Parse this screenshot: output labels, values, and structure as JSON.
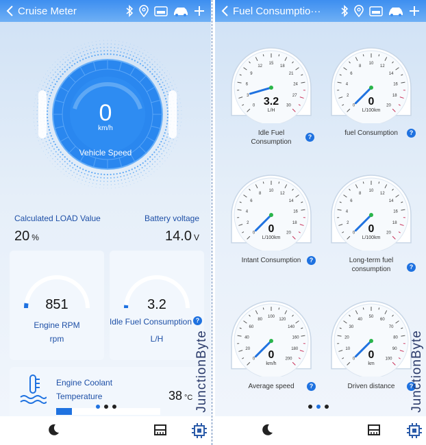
{
  "left": {
    "title": "Cruise Meter",
    "speed": {
      "value": "0",
      "unit": "km/h",
      "label": "Vehicle Speed"
    },
    "load": {
      "label": "Calculated LOAD Value",
      "value": "20",
      "unit": "%"
    },
    "battery": {
      "label": "Battery voltage",
      "value": "14.0",
      "unit": "V"
    },
    "rpm": {
      "value": "851",
      "label": "Engine RPM",
      "unit": "rpm",
      "fraction": 0.05
    },
    "idle": {
      "value": "3.2",
      "label": "Idle Fuel Consumption",
      "unit": "L/H",
      "fraction": 0.03
    },
    "coolant": {
      "label_line1": "Engine Coolant",
      "label_line2": "Temperature",
      "value": "38",
      "unit": "°C",
      "fraction": 0.15
    },
    "watermark": "JunctionByte"
  },
  "right": {
    "title": "Fuel Consumptio···",
    "watermark": "JunctionByte",
    "gauges": [
      {
        "value": "3.2",
        "unit": "L/H",
        "label_line1": "Idle Fuel",
        "label_line2": "Consumption",
        "ticks": [
          "0",
          "3",
          "6",
          "9",
          "12",
          "15",
          "18",
          "21",
          "24",
          "27",
          "30"
        ],
        "fraction": 0.107
      },
      {
        "value": "0",
        "unit": "L/100km",
        "label_line1": "fuel Consumption",
        "label_line2": "",
        "ticks": [
          "0",
          "2",
          "4",
          "6",
          "8",
          "10",
          "12",
          "14",
          "16",
          "18",
          "20"
        ],
        "fraction": 0
      },
      {
        "value": "0",
        "unit": "L/100km",
        "label_line1": "Intant Consumption",
        "label_line2": "",
        "ticks": [
          "0",
          "2",
          "4",
          "6",
          "8",
          "10",
          "12",
          "14",
          "16",
          "18",
          "20"
        ],
        "fraction": 0
      },
      {
        "value": "0",
        "unit": "L/100km",
        "label_line1": "Long-term fuel",
        "label_line2": "consumption",
        "ticks": [
          "0",
          "2",
          "4",
          "6",
          "8",
          "10",
          "12",
          "14",
          "16",
          "18",
          "20"
        ],
        "fraction": 0
      },
      {
        "value": "0",
        "unit": "km/h",
        "label_line1": "Average speed",
        "label_line2": "",
        "ticks": [
          "0",
          "20",
          "40",
          "60",
          "80",
          "100",
          "120",
          "140",
          "160",
          "180",
          "200"
        ],
        "fraction": 0
      },
      {
        "value": "0",
        "unit": "km",
        "label_line1": "Driven distance",
        "label_line2": "",
        "ticks": [
          "0",
          "10",
          "20",
          "30",
          "40",
          "50",
          "60",
          "70",
          "80",
          "90",
          "100"
        ],
        "fraction": 0
      }
    ]
  },
  "colors": {
    "accent": "#1f72e0",
    "header": "#3d8ef0",
    "needle": "#1f72e0",
    "center_dot": "#2ab54a"
  },
  "icons": [
    "back-icon",
    "bluetooth-icon",
    "location-icon",
    "obd-icon",
    "car-icon",
    "plus-icon",
    "moon-icon",
    "dashboard-icon",
    "logo-icon"
  ]
}
